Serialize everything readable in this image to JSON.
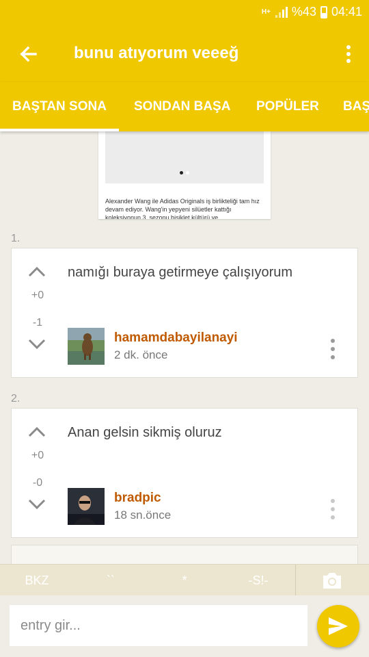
{
  "status_bar": {
    "network": "H+",
    "battery": "%43",
    "time": "04:41"
  },
  "app_bar": {
    "title": "bunu atıyorum veeeğ"
  },
  "tabs": [
    {
      "label": "BAŞTAN SONA",
      "active": true
    },
    {
      "label": "SONDAN BAŞA",
      "active": false
    },
    {
      "label": "POPÜLER",
      "active": false
    },
    {
      "label": "BAŞ",
      "active": false
    }
  ],
  "preview": {
    "text": "Alexander Wang ile Adidas Originals iş birlikteliği tam hız devam ediyor. Wang'in yepyeni silüetler kattığı koleksiyonun 3. sezonu bisiklet kültürü ve"
  },
  "entries": [
    {
      "index": "1.",
      "text": "namığı buraya getirmeye çalışıyorum",
      "score_plus": "+0",
      "score_minus": "-1",
      "author": "hamamdabayilanayi",
      "time": "2 dk. önce"
    },
    {
      "index": "2.",
      "text": "Anan gelsin sikmiş oluruz",
      "score_plus": "+0",
      "score_minus": "-0",
      "author": "bradpic",
      "time": "18 sn.önce"
    }
  ],
  "toolbar": {
    "bkz": "BKZ",
    "backticks": "``",
    "asterisk": "*",
    "spoiler": "-S!-"
  },
  "composer": {
    "placeholder": "entry gir..."
  },
  "colors": {
    "brand_yellow": "#f0c800",
    "author_orange": "#c05a00",
    "background": "#efede6"
  }
}
